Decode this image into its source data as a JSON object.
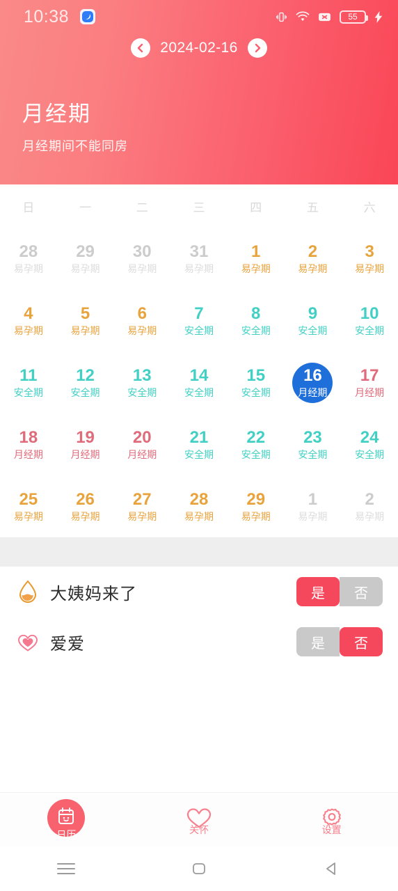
{
  "statusbar": {
    "time": "10:38",
    "app_icon": "app-notification-icon",
    "icons": [
      "vibrate-icon",
      "wifi-icon",
      "no-sim-icon",
      "battery-icon",
      "charging-bolt-icon"
    ],
    "battery_level": "55"
  },
  "header": {
    "date": "2024-02-16",
    "prev_icon": "chevron-left-icon",
    "next_icon": "chevron-right-icon",
    "title": "月经期",
    "subtitle": "月经期间不能同房",
    "gradient_from": "#fa8a88",
    "gradient_to": "#fa4656"
  },
  "calendar": {
    "weekdays": [
      "日",
      "一",
      "二",
      "三",
      "四",
      "五",
      "六"
    ],
    "phase_colors": {
      "fertile": "#e8a33d",
      "safe": "#42d0c5",
      "menstrual": "#e06b7b",
      "muted": "#cccccc",
      "selected_bg": "#1f6fdb"
    },
    "days": [
      {
        "day": "28",
        "tag": "易孕期",
        "phase": "muted",
        "selected": false
      },
      {
        "day": "29",
        "tag": "易孕期",
        "phase": "muted",
        "selected": false
      },
      {
        "day": "30",
        "tag": "易孕期",
        "phase": "muted",
        "selected": false
      },
      {
        "day": "31",
        "tag": "易孕期",
        "phase": "muted",
        "selected": false
      },
      {
        "day": "1",
        "tag": "易孕期",
        "phase": "fertile",
        "selected": false
      },
      {
        "day": "2",
        "tag": "易孕期",
        "phase": "fertile",
        "selected": false
      },
      {
        "day": "3",
        "tag": "易孕期",
        "phase": "fertile",
        "selected": false
      },
      {
        "day": "4",
        "tag": "易孕期",
        "phase": "fertile",
        "selected": false
      },
      {
        "day": "5",
        "tag": "易孕期",
        "phase": "fertile",
        "selected": false
      },
      {
        "day": "6",
        "tag": "易孕期",
        "phase": "fertile",
        "selected": false
      },
      {
        "day": "7",
        "tag": "安全期",
        "phase": "safe",
        "selected": false
      },
      {
        "day": "8",
        "tag": "安全期",
        "phase": "safe",
        "selected": false
      },
      {
        "day": "9",
        "tag": "安全期",
        "phase": "safe",
        "selected": false
      },
      {
        "day": "10",
        "tag": "安全期",
        "phase": "safe",
        "selected": false
      },
      {
        "day": "11",
        "tag": "安全期",
        "phase": "safe",
        "selected": false
      },
      {
        "day": "12",
        "tag": "安全期",
        "phase": "safe",
        "selected": false
      },
      {
        "day": "13",
        "tag": "安全期",
        "phase": "safe",
        "selected": false
      },
      {
        "day": "14",
        "tag": "安全期",
        "phase": "safe",
        "selected": false
      },
      {
        "day": "15",
        "tag": "安全期",
        "phase": "safe",
        "selected": false
      },
      {
        "day": "16",
        "tag": "月经期",
        "phase": "menstrual",
        "selected": true
      },
      {
        "day": "17",
        "tag": "月经期",
        "phase": "menstrual",
        "selected": false
      },
      {
        "day": "18",
        "tag": "月经期",
        "phase": "menstrual",
        "selected": false
      },
      {
        "day": "19",
        "tag": "月经期",
        "phase": "menstrual",
        "selected": false
      },
      {
        "day": "20",
        "tag": "月经期",
        "phase": "menstrual",
        "selected": false
      },
      {
        "day": "21",
        "tag": "安全期",
        "phase": "safe",
        "selected": false
      },
      {
        "day": "22",
        "tag": "安全期",
        "phase": "safe",
        "selected": false
      },
      {
        "day": "23",
        "tag": "安全期",
        "phase": "safe",
        "selected": false
      },
      {
        "day": "24",
        "tag": "安全期",
        "phase": "safe",
        "selected": false
      },
      {
        "day": "25",
        "tag": "易孕期",
        "phase": "fertile",
        "selected": false
      },
      {
        "day": "26",
        "tag": "易孕期",
        "phase": "fertile",
        "selected": false
      },
      {
        "day": "27",
        "tag": "易孕期",
        "phase": "fertile",
        "selected": false
      },
      {
        "day": "28",
        "tag": "易孕期",
        "phase": "fertile",
        "selected": false
      },
      {
        "day": "29",
        "tag": "易孕期",
        "phase": "fertile",
        "selected": false
      },
      {
        "day": "1",
        "tag": "易孕期",
        "phase": "muted",
        "selected": false
      },
      {
        "day": "2",
        "tag": "易孕期",
        "phase": "muted",
        "selected": false
      }
    ]
  },
  "records": {
    "yes_label": "是",
    "no_label": "否",
    "active_color": "#f5485c",
    "inactive_color": "#c9c9c9",
    "rows": [
      {
        "icon": "blood-drop-icon",
        "label": "大姨妈来了",
        "value": "yes"
      },
      {
        "icon": "double-heart-icon",
        "label": "爱爱",
        "value": "no"
      }
    ]
  },
  "tabbar": {
    "accent": "#f8626f",
    "tabs": [
      {
        "label": "日历",
        "icon": "calendar-icon",
        "active": true
      },
      {
        "label": "关怀",
        "icon": "heart-icon",
        "active": false
      },
      {
        "label": "设置",
        "icon": "gear-icon",
        "active": false
      }
    ]
  },
  "androidnav": {
    "buttons": [
      "recents-icon",
      "home-icon",
      "back-icon"
    ]
  }
}
